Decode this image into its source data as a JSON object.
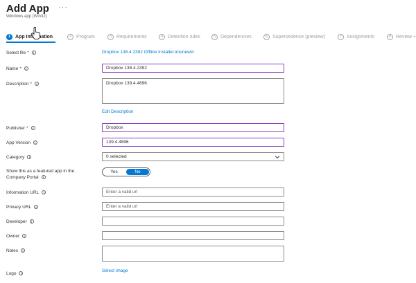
{
  "header": {
    "title": "Add App",
    "more_label": "···",
    "subtitle": "Windows app (Win32)"
  },
  "steps": [
    {
      "num": "1",
      "label": "App Information"
    },
    {
      "num": "2",
      "label": "Program"
    },
    {
      "num": "3",
      "label": "Requirements"
    },
    {
      "num": "4",
      "label": "Detection rules"
    },
    {
      "num": "5",
      "label": "Dependencies"
    },
    {
      "num": "6",
      "label": "Supersedence (preview)"
    },
    {
      "num": "7",
      "label": "Assignments"
    },
    {
      "num": "8",
      "label": "Review +"
    }
  ],
  "form": {
    "select_file": {
      "label": "Select file",
      "required": "*",
      "info": "i",
      "value": "Dropbox 138.4.2392 Offline Installer.intunewin"
    },
    "name": {
      "label": "Name",
      "required": "*",
      "info": "i",
      "value": "Dropbox 138.4.2392"
    },
    "description": {
      "label": "Description",
      "required": "*",
      "info": "i",
      "value": "Dropbox 139.4.4896"
    },
    "edit_description": "Edit Description",
    "publisher": {
      "label": "Publisher",
      "required": "*",
      "info": "i",
      "value": "Dropbox"
    },
    "app_version": {
      "label": "App Version",
      "info": "i",
      "value": "139.4.4896"
    },
    "category": {
      "label": "Category",
      "info": "i",
      "value": "0 selected"
    },
    "featured": {
      "label_line1": "Show this as a featured app in the",
      "label_line2": "Company Portal",
      "info": "i",
      "yes": "Yes",
      "no": "No",
      "selected": "No"
    },
    "information_url": {
      "label": "Information URL",
      "info": "i",
      "placeholder": "Enter a valid url"
    },
    "privacy_url": {
      "label": "Privacy URL",
      "info": "i",
      "placeholder": "Enter a valid url"
    },
    "developer": {
      "label": "Developer",
      "info": "i",
      "value": ""
    },
    "owner": {
      "label": "Owner",
      "info": "i",
      "value": ""
    },
    "notes": {
      "label": "Notes",
      "info": "i",
      "value": ""
    },
    "logo": {
      "label": "Logo",
      "info": "i",
      "link": "Select image"
    }
  },
  "colors": {
    "accent": "#0078d4",
    "focus_border": "#8a3ebf",
    "required": "#a4262c"
  }
}
